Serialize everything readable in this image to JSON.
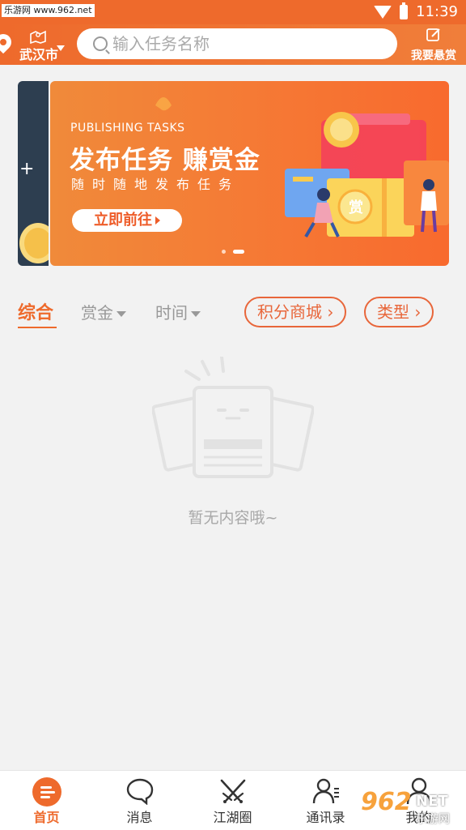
{
  "status_bar": {
    "watermark": "乐游网 www.962.net",
    "time": "11:39"
  },
  "header": {
    "city": "武汉市",
    "search_placeholder": "输入任务名称",
    "post_reward_label": "我要悬赏"
  },
  "banner": {
    "subtitle": "PUBLISHING TASKS",
    "title": "发布任务 赚赏金",
    "description": "随时随地发布任务",
    "cta_label": "立即前往",
    "badge_char": "赏",
    "slide_count": 2,
    "active_slide": 2
  },
  "filters": {
    "main": "综合",
    "reward": "赏金",
    "time": "时间",
    "points_mall": "积分商城",
    "type": "类型"
  },
  "empty_state": {
    "text": "暂无内容哦~"
  },
  "tabbar": {
    "items": [
      {
        "label": "首页",
        "icon": "home-list-icon",
        "active": true
      },
      {
        "label": "消息",
        "icon": "chat-bubble-icon",
        "active": false
      },
      {
        "label": "江湖圈",
        "icon": "crossed-swords-icon",
        "active": false
      },
      {
        "label": "通讯录",
        "icon": "contacts-icon",
        "active": false
      },
      {
        "label": "我的",
        "icon": "user-icon",
        "active": false
      }
    ]
  },
  "watermark_bottom": {
    "number": "962",
    "net": "NET",
    "name": "乐游网"
  },
  "colors": {
    "brand": "#ee6a2c",
    "accent_pill": "#e8663a",
    "muted_text": "#999999"
  }
}
